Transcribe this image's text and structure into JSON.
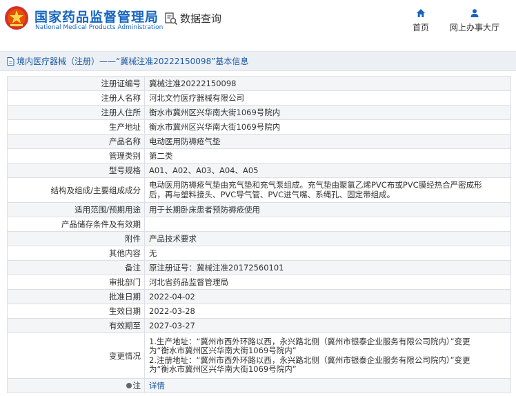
{
  "header": {
    "site_name_cn": "国家药品监督管理局",
    "site_name_en": "National Medical Products Administration",
    "query_label": "数据查询",
    "nav_home": "首页",
    "nav_online_hall": "网上办事大厅",
    "brand_color": "#1565c0",
    "emblem_color": "#d32f2f"
  },
  "breadcrumb": "境内医疗器械（注册）——“冀械注准20222150098”基本信息",
  "rows": [
    {
      "label": "注册证编号",
      "value": "冀械注准20222150098"
    },
    {
      "label": "注册人名称",
      "value": "河北文竹医疗器械有限公司"
    },
    {
      "label": "注册人住所",
      "value": "衡水市冀州区兴华南大街1069号院内"
    },
    {
      "label": "生产地址",
      "value": "衡水市冀州区兴华南大街1069号院内"
    },
    {
      "label": "产品名称",
      "value": "电动医用防褥疮气垫"
    },
    {
      "label": "管理类别",
      "value": "第二类"
    },
    {
      "label": "型号规格",
      "value": "A01、A02、A03、A04、A05"
    },
    {
      "label": "结构及组成/主要组成成分",
      "lines": [
        "电动医用防褥疮气垫由充气垫和充气泵组成。充气垫由聚氯乙烯PVC布或PVC膜经热合严密成形",
        "后，再与塑料接头、PVC导气管、PVC进气嘴、系绳孔、固定带组成。"
      ]
    },
    {
      "label": "适用范围/预期用途",
      "value": "用于长期卧床患者预防褥疮使用"
    },
    {
      "label": "产品储存条件及有效期",
      "value": ""
    },
    {
      "label": "附件",
      "value": "产品技术要求"
    },
    {
      "label": "其他内容",
      "value": "无"
    },
    {
      "label": "备注",
      "value": "原注册证号：冀械注准20172560101"
    },
    {
      "label": "审批部门",
      "value": "河北省药品监督管理局"
    },
    {
      "label": "批准日期",
      "value": "2022-04-02"
    },
    {
      "label": "生效日期",
      "value": "2022-03-28"
    },
    {
      "label": "有效期至",
      "value": "2027-03-27"
    },
    {
      "label": "变更情况",
      "lines": [
        "1.生产地址：“冀州市西外环路以西，永兴路北侧（冀州市银泰企业服务有限公司院内）”变更",
        "为“衡水市冀州区兴华南大街1069号院内”",
        "2.注册地址：“冀州市西外环路以西，永兴路北侧（冀州市银泰企业服务有限公司院内）”变更",
        "为“衡水市冀州区兴华南大街1069号院内”"
      ]
    },
    {
      "label": "注",
      "value": "详情",
      "is_link": true
    }
  ]
}
